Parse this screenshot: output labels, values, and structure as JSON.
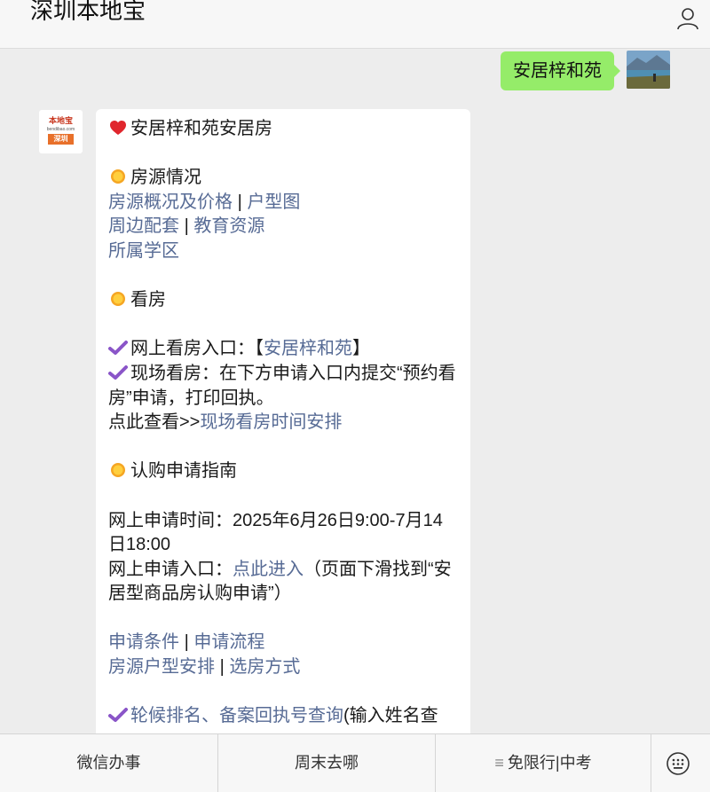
{
  "app": {
    "title": "深圳本地宝"
  },
  "chat": {
    "outgoing_message": "安居梓和苑",
    "reply": {
      "heading": "安居梓和苑安居房",
      "section1": {
        "title": "房源情况"
      },
      "link_overview": "房源概况及价格",
      "link_floorplan": "户型图",
      "link_facilities": "周边配套",
      "link_education": "教育资源",
      "link_school_district": "所属学区",
      "sep": "|",
      "section2": {
        "title": "看房"
      },
      "online_viewing_label": "网上看房入口：",
      "bracket_open": "【",
      "online_viewing_link": "安居梓和苑",
      "bracket_close": "】",
      "onsite_viewing_text": "现场看房：在下方申请入口内提交“预约看房”申请，打印回执。",
      "check_prefix": "点此查看>>",
      "onsite_schedule_link": "现场看房时间安排",
      "section3": {
        "title": "认购申请指南"
      },
      "apply_time": "网上申请时间：2025年6月26日9:00-7月14日18:00",
      "apply_entry_label": "网上申请入口：",
      "apply_entry_link": "点此进入",
      "apply_entry_note": "（页面下滑找到“安居型商品房认购申请”）",
      "link_conditions": "申请条件",
      "link_process": "申请流程",
      "link_unit_arrangement": "房源户型安排",
      "link_selection_method": "选房方式",
      "waitlist_link": "轮候排名、备案回执号查询",
      "waitlist_suffix": "(输入姓名查"
    }
  },
  "bottom_menu": {
    "item1": "微信办事",
    "item2": "周末去哪",
    "item3_icon": "≡",
    "item3": "免限行|中考"
  },
  "colors": {
    "link": "#576b95",
    "outgoing_bubble": "#95ec69",
    "background": "#ededed"
  },
  "icons": [
    "profile-icon",
    "heart-icon",
    "sun-icon",
    "check-icon",
    "keyboard-icon"
  ]
}
